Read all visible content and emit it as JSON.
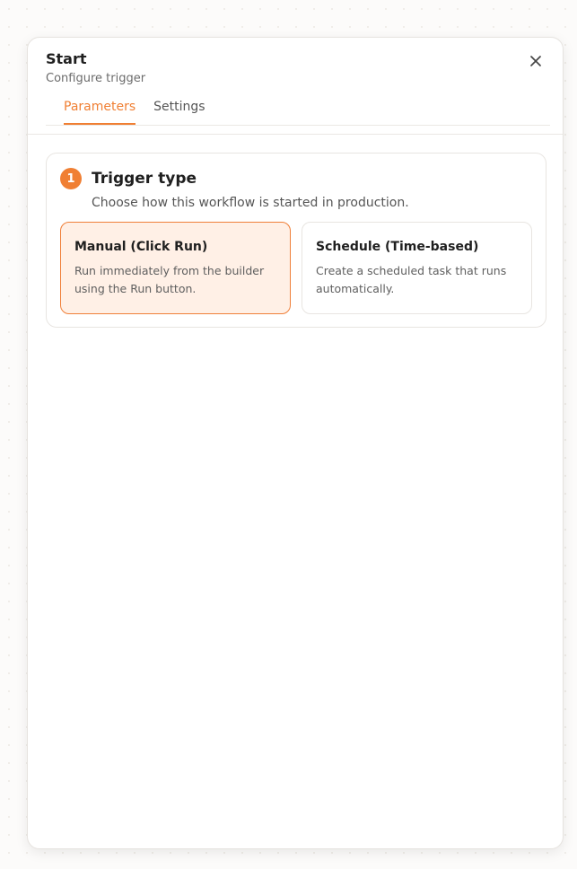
{
  "panel": {
    "title": "Start",
    "subtitle": "Configure trigger",
    "close_icon": "close-icon"
  },
  "tabs": [
    {
      "label": "Parameters",
      "active": true
    },
    {
      "label": "Settings",
      "active": false
    }
  ],
  "section": {
    "step": "1",
    "title": "Trigger type",
    "description": "Choose how this workflow is started in production.",
    "options": [
      {
        "title": "Manual (Click Run)",
        "description": "Run immediately from the builder using the Run button.",
        "selected": true
      },
      {
        "title": "Schedule (Time-based)",
        "description": "Create a scheduled task that runs automatically.",
        "selected": false
      }
    ]
  },
  "colors": {
    "accent": "#f07f33",
    "selected_bg": "#fff0e6"
  }
}
